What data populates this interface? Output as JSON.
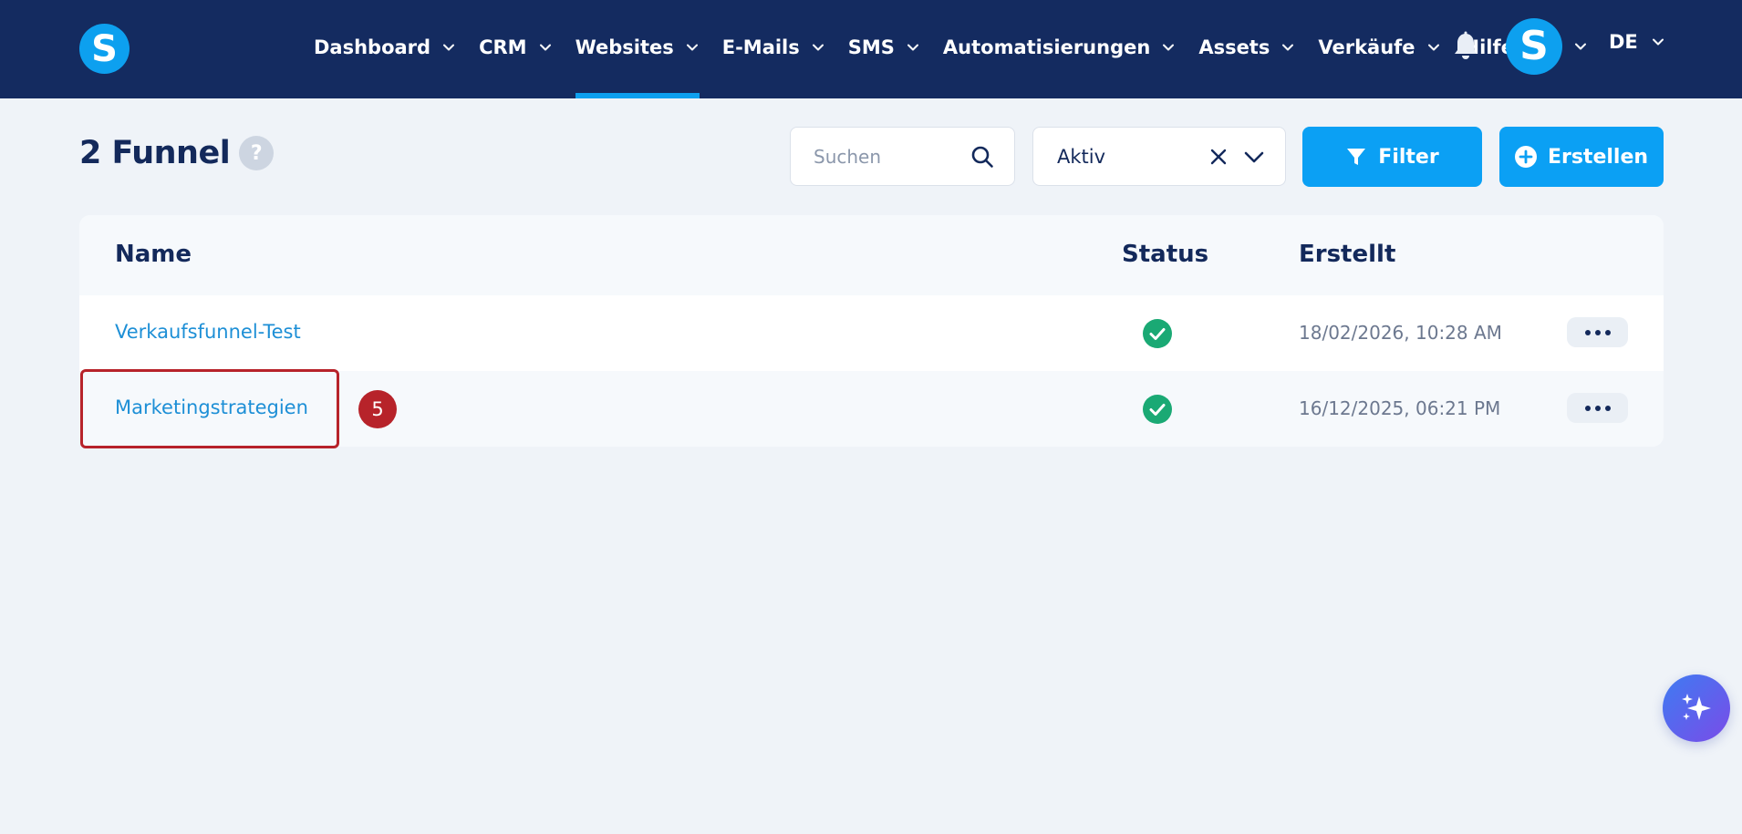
{
  "app": {
    "logo_letter": "S",
    "avatar_letter": "S"
  },
  "nav": {
    "items": [
      {
        "label": "Dashboard",
        "has_dropdown": true,
        "active": false
      },
      {
        "label": "CRM",
        "has_dropdown": true,
        "active": false
      },
      {
        "label": "Websites",
        "has_dropdown": true,
        "active": true
      },
      {
        "label": "E-Mails",
        "has_dropdown": true,
        "active": false
      },
      {
        "label": "SMS",
        "has_dropdown": true,
        "active": false
      },
      {
        "label": "Automatisierungen",
        "has_dropdown": true,
        "active": false
      },
      {
        "label": "Assets",
        "has_dropdown": true,
        "active": false
      },
      {
        "label": "Verkäufe",
        "has_dropdown": true,
        "active": false
      },
      {
        "label": "Hilfe",
        "has_dropdown": false,
        "active": false
      }
    ],
    "language": "DE"
  },
  "toolbar": {
    "title": "2 Funnel",
    "help_label": "?",
    "search_placeholder": "Suchen",
    "status_filter_value": "Aktiv",
    "filter_label": "Filter",
    "create_label": "Erstellen"
  },
  "table": {
    "headers": {
      "name": "Name",
      "status": "Status",
      "created": "Erstellt"
    },
    "rows": [
      {
        "name": "Verkaufsfunnel-Test",
        "status": "active",
        "created": "18/02/2026, 10:28 AM"
      },
      {
        "name": "Marketingstrategien",
        "status": "active",
        "created": "16/12/2025, 06:21 PM"
      }
    ]
  },
  "annotation": {
    "step_number": "5"
  },
  "colors": {
    "navbar_bg": "#142b60",
    "accent": "#0ba0f4",
    "status_ok": "#1aa974",
    "highlight": "#b7232a",
    "link": "#1d8fd6"
  }
}
